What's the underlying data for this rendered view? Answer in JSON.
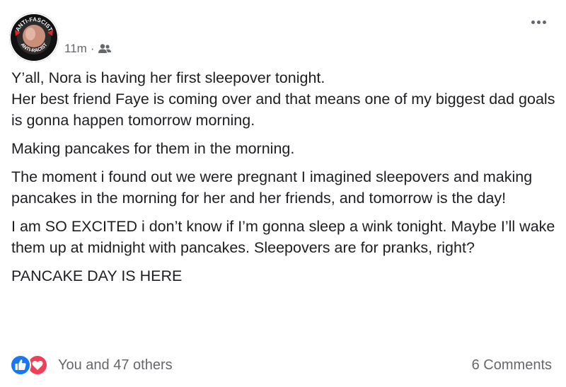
{
  "header": {
    "avatar": {
      "icon": "anti-fascist-badge-avatar",
      "badge_top_text": "ANTI-FASCIST",
      "badge_bottom_text": "ANTI-RACIST"
    },
    "timestamp": "11m",
    "separator": "·",
    "audience_icon": "friends-icon",
    "more_icon": "more-options-icon"
  },
  "post": {
    "paragraphs": [
      "Y’all, Nora is having her first sleepover tonight.\nHer best friend Faye is coming over and that means one of my biggest dad goals is gonna happen tomorrow morning.",
      "Making pancakes for them in the morning.",
      "The moment i found out we were pregnant I imagined sleepovers and making pancakes in the morning for her and her friends, and tomorrow is the day!",
      "I am SO EXCITED i don’t know if I’m gonna sleep a wink tonight. Maybe I’ll wake them up at midnight with pancakes. Sleepovers are for pranks, right?",
      "PANCAKE DAY IS HERE"
    ]
  },
  "footer": {
    "reaction_icons": [
      "like-icon",
      "love-icon"
    ],
    "reactions_text": "You and 47 others",
    "comments_text": "6 Comments"
  },
  "colors": {
    "text": "#1c1e21",
    "secondary_text": "#65676b",
    "like_blue": "#1877f2",
    "love_red": "#f33e58",
    "badge_red": "#d62828"
  }
}
